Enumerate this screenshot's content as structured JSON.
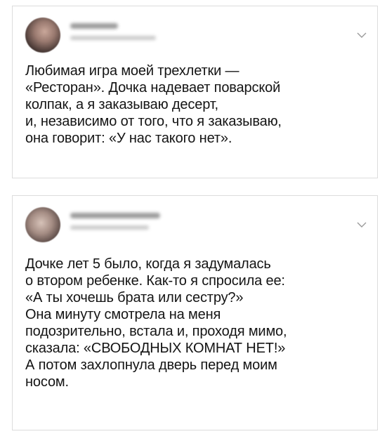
{
  "tweets": [
    {
      "lines": [
        "Любимая игра моей трехлетки —",
        "«Ресторан». Дочка надевает поварской",
        "колпак, а я заказываю десерт,",
        "и, независимо от того, что я заказываю,",
        "она говорит: «У нас такого нет»."
      ]
    },
    {
      "lines": [
        "Дочке лет 5 было, когда я задумалась",
        "о втором ребенке. Как-то я спросила ее:",
        "«А ты хочешь брата или сестру?»",
        "Она минуту смотрела на меня",
        "подозрительно, встала и, проходя мимо,",
        "сказала: «СВОБОДНЫХ КОМНАТ НЕТ!»",
        "А потом захлопнула дверь перед моим",
        "носом."
      ]
    }
  ],
  "icons": {
    "avatar": "avatar",
    "menu": "chevron-down-icon"
  },
  "colors": {
    "card_border": "#dcdcdc",
    "text": "#141414",
    "chevron": "#9a9a9a"
  }
}
